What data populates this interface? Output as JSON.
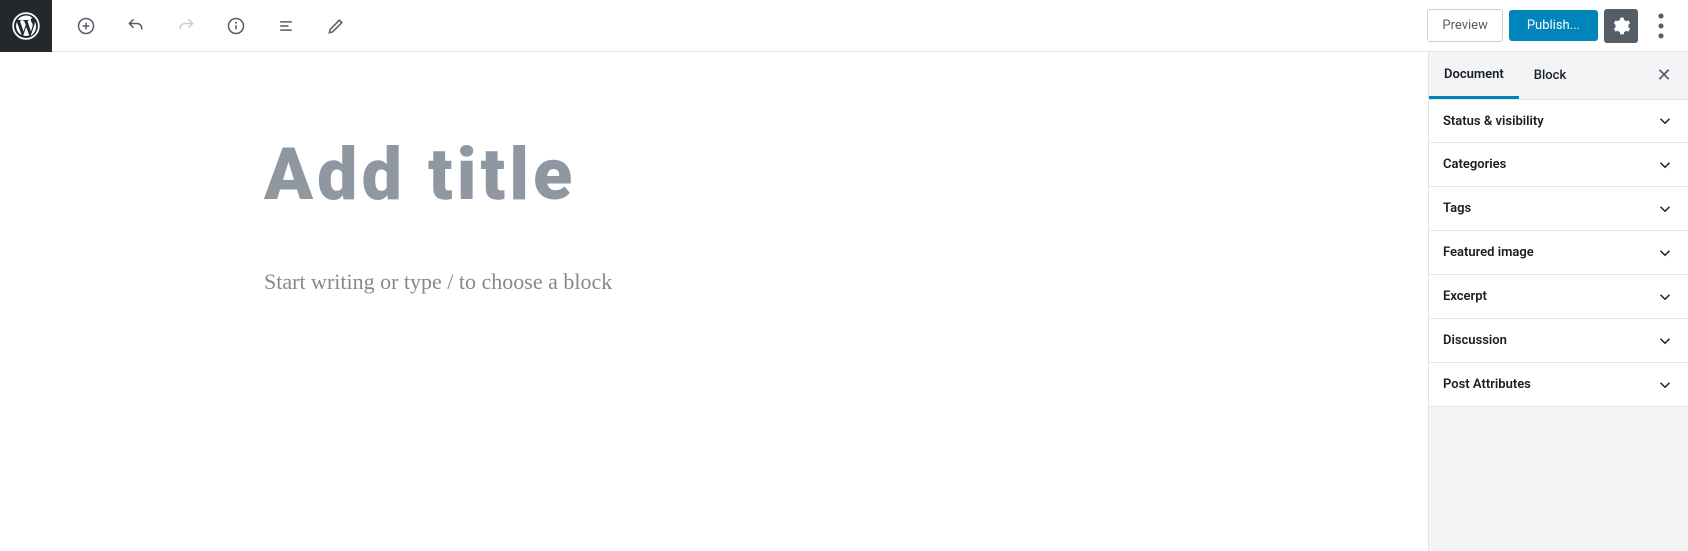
{
  "toolbar": {
    "preview_label": "Preview",
    "publish_label": "Publish..."
  },
  "editor": {
    "title_placeholder": "Add title",
    "body_placeholder": "Start writing or type / to choose a block"
  },
  "sidebar": {
    "tabs": {
      "document": "Document",
      "block": "Block"
    },
    "panels": [
      "Status & visibility",
      "Categories",
      "Tags",
      "Featured image",
      "Excerpt",
      "Discussion",
      "Post Attributes"
    ]
  }
}
